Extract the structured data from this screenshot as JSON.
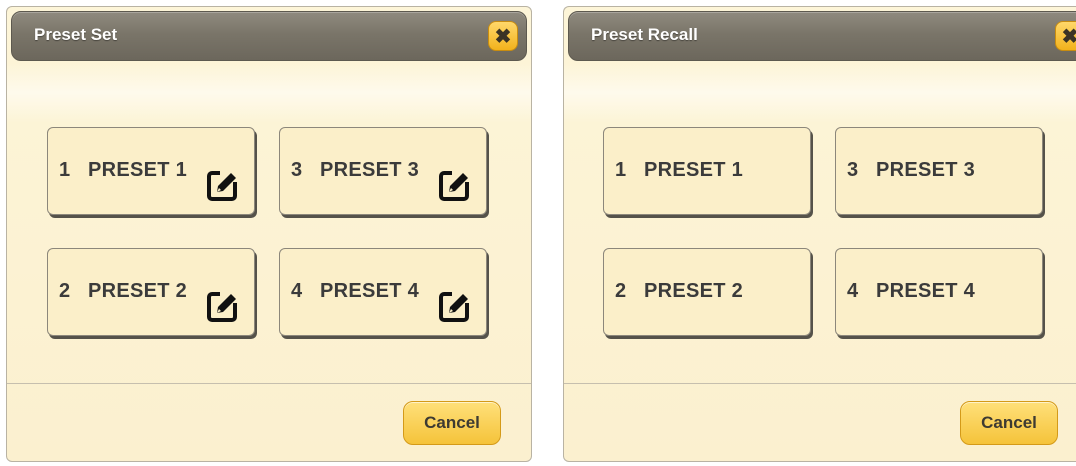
{
  "preset_set": {
    "title": "Preset Set",
    "close_icon": "close-icon",
    "presets": [
      {
        "num": "1",
        "label": "PRESET 1",
        "icon": "edit-icon"
      },
      {
        "num": "2",
        "label": "PRESET 2",
        "icon": "edit-icon"
      },
      {
        "num": "3",
        "label": "PRESET 3",
        "icon": "edit-icon"
      },
      {
        "num": "4",
        "label": "PRESET 4",
        "icon": "edit-icon"
      }
    ],
    "cancel_label": "Cancel"
  },
  "preset_recall": {
    "title": "Preset Recall",
    "close_icon": "close-icon",
    "presets": [
      {
        "num": "1",
        "label": "PRESET 1"
      },
      {
        "num": "2",
        "label": "PRESET 2"
      },
      {
        "num": "3",
        "label": "PRESET 3"
      },
      {
        "num": "4",
        "label": "PRESET 4"
      }
    ],
    "cancel_label": "Cancel"
  },
  "colors": {
    "dialog_bg": "#fbf0cf",
    "titlebar": "#7a7569",
    "accent_button": "#f5c33a",
    "preset_tile": "#fbefc9"
  }
}
